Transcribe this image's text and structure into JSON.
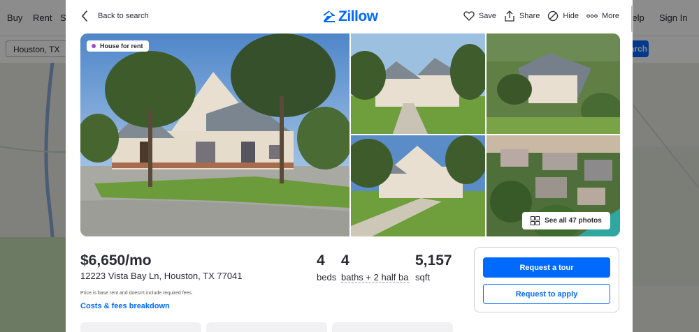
{
  "background": {
    "nav": {
      "buy": "Buy",
      "rent": "Rent",
      "sell_initial": "S",
      "help": "Help",
      "sign_in": "Sign In"
    },
    "search_value": "Houston, TX",
    "search_button": "Search"
  },
  "header": {
    "back_label": "Back to search",
    "logo_text": "Zillow",
    "actions": {
      "save": "Save",
      "share": "Share",
      "hide": "Hide",
      "more": "More"
    }
  },
  "gallery": {
    "badge": "House for rent",
    "see_all": "See all 47 photos"
  },
  "listing": {
    "price": "$6,650/mo",
    "address": "12223 Vista Bay Ln, Houston, TX 77041",
    "beds_num": "4",
    "beds_label": "beds",
    "baths_num": "4",
    "baths_label": "baths + 2 half ba",
    "sqft_num": "5,157",
    "sqft_label": "sqft",
    "fine_print": "Price is base rent and doesn't include required fees.",
    "fees_link": "Costs & fees breakdown"
  },
  "cta": {
    "request_tour": "Request a tour",
    "request_apply": "Request to apply"
  },
  "colors": {
    "brand": "#006aff",
    "badge_dot": "#a349c6",
    "text": "#2a2a33"
  },
  "icons": [
    "chevron-left-icon",
    "zillow-logo-icon",
    "heart-icon",
    "share-icon",
    "hide-icon",
    "more-icon",
    "grid-icon"
  ]
}
